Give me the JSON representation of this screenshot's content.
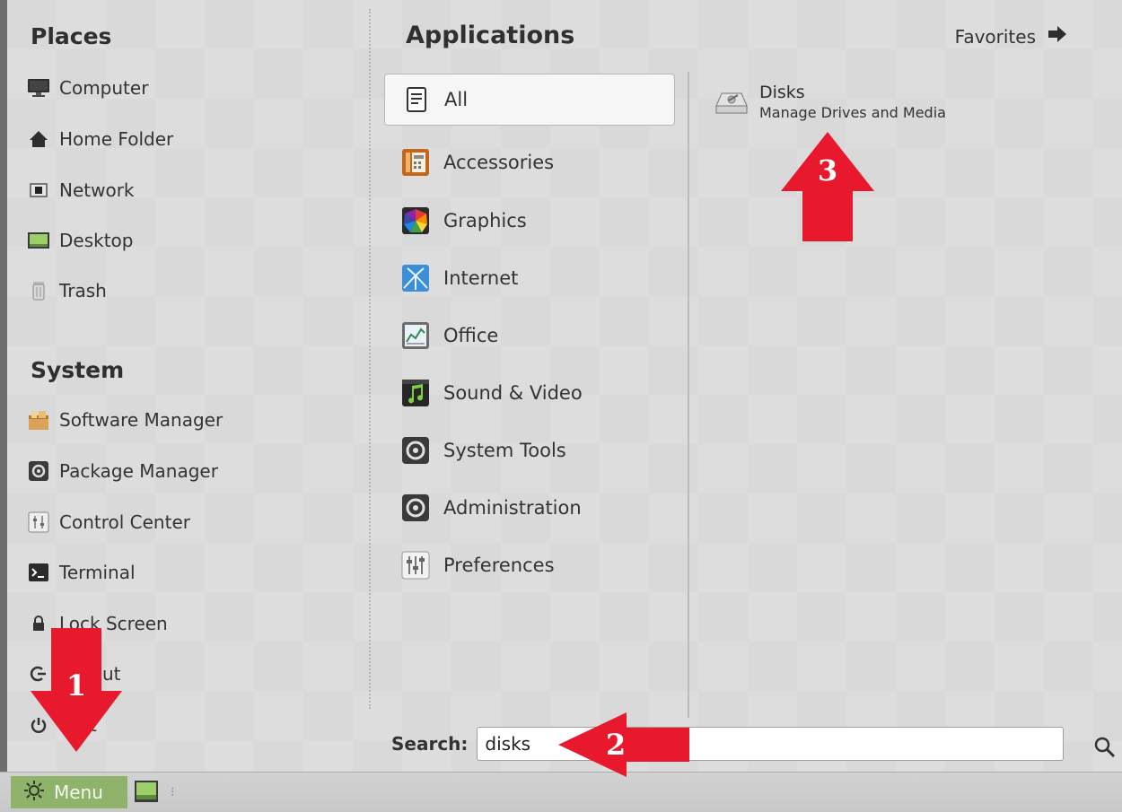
{
  "places": {
    "title": "Places",
    "items": [
      {
        "label": "Computer",
        "icon": "monitor-icon"
      },
      {
        "label": "Home Folder",
        "icon": "home-icon"
      },
      {
        "label": "Network",
        "icon": "network-icon"
      },
      {
        "label": "Desktop",
        "icon": "desktop-icon"
      },
      {
        "label": "Trash",
        "icon": "trash-icon"
      }
    ]
  },
  "system": {
    "title": "System",
    "items": [
      {
        "label": "Software Manager",
        "icon": "software-manager-icon"
      },
      {
        "label": "Package Manager",
        "icon": "package-manager-icon"
      },
      {
        "label": "Control Center",
        "icon": "control-center-icon"
      },
      {
        "label": "Terminal",
        "icon": "terminal-icon"
      },
      {
        "label": "Lock Screen",
        "icon": "lock-icon"
      },
      {
        "label": "Logout",
        "icon": "logout-icon"
      },
      {
        "label": "Quit",
        "icon": "power-icon"
      }
    ]
  },
  "applications": {
    "title": "Applications",
    "favorites_label": "Favorites",
    "categories": [
      {
        "label": "All",
        "icon": "all-list-icon",
        "selected": true
      },
      {
        "label": "Accessories",
        "icon": "accessories-icon"
      },
      {
        "label": "Graphics",
        "icon": "graphics-icon"
      },
      {
        "label": "Internet",
        "icon": "internet-icon"
      },
      {
        "label": "Office",
        "icon": "office-icon"
      },
      {
        "label": "Sound & Video",
        "icon": "sound-video-icon"
      },
      {
        "label": "System Tools",
        "icon": "system-tools-icon"
      },
      {
        "label": "Administration",
        "icon": "administration-icon"
      },
      {
        "label": "Preferences",
        "icon": "preferences-icon"
      }
    ],
    "results": [
      {
        "name": "Disks",
        "description": "Manage Drives and Media",
        "icon": "disks-icon"
      }
    ]
  },
  "search": {
    "label": "Search:",
    "value": "disks"
  },
  "taskbar": {
    "menu_label": "Menu"
  },
  "annotations": {
    "step1": "1",
    "step2": "2",
    "step3": "3",
    "arrow_color": "#e8192c"
  },
  "colors": {
    "menu_button_bg": "#8fb36b"
  }
}
